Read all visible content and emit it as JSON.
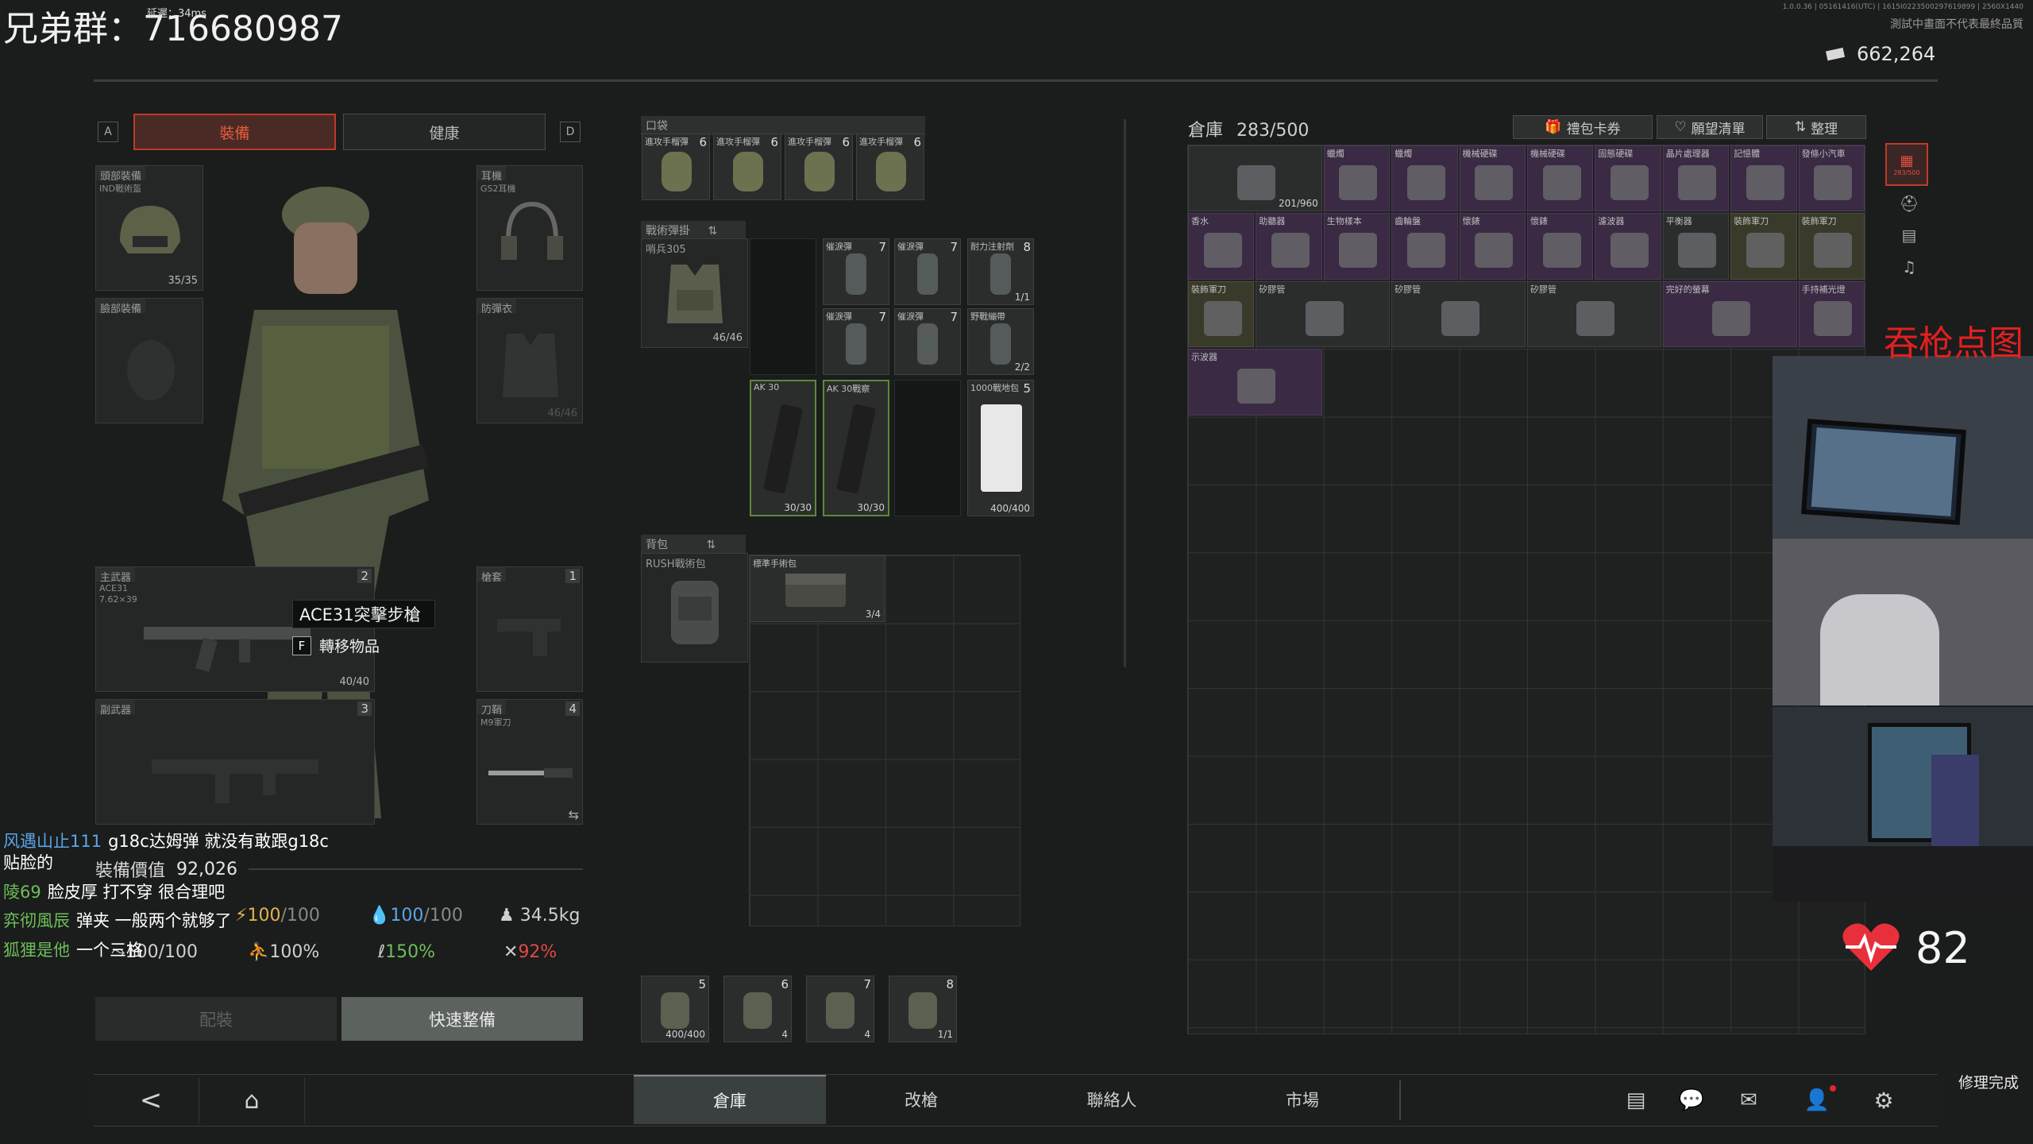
{
  "overlay": {
    "group_text": "兄弟群：716680987",
    "small_top": "毎出直戦地区",
    "delay_text": "延遲：34ms",
    "build_info": "1.0.0.36 | 05161416(UTC) | 1615I0223500297619899 | 2560X1440",
    "test_notice": "測試中畫面不代表最終品質"
  },
  "currency": {
    "amount": "662,264"
  },
  "loadout_tabs": {
    "left_key": "A",
    "equip": "裝備",
    "health": "健康",
    "right_key": "D"
  },
  "slots": {
    "head": {
      "label": "頭部裝備",
      "item": "IND戰術盔",
      "count": "35/35"
    },
    "earpiece": {
      "label": "耳機",
      "item": "GS2耳機"
    },
    "face": {
      "label": "臉部裝備"
    },
    "armor": {
      "label": "防彈衣",
      "count": "46/46"
    },
    "primary": {
      "label": "主武器",
      "item": "ACE31",
      "caliber": "7.62×39",
      "badge": "2",
      "count": "40/40"
    },
    "holster": {
      "label": "槍套",
      "badge": "1"
    },
    "secondary": {
      "label": "副武器",
      "badge": "3"
    },
    "knife": {
      "label": "刀鞘",
      "item": "M9軍刀",
      "badge": "4"
    }
  },
  "tooltip": {
    "title": "ACE31突擊步槍",
    "key": "F",
    "action": "轉移物品"
  },
  "stats": {
    "equip_value_label": "裝備價值",
    "equip_value": "92,026",
    "energy": "100",
    "energy_max": "/100",
    "water": "100",
    "water_max": "/100",
    "weight": "34.5kg",
    "stamina": "100/100",
    "speed": "100%",
    "stat3": "150%",
    "stat4": "92%"
  },
  "buttons": {
    "loadout": "配裝",
    "quick_equip": "快速整備",
    "repair_done": "修理完成"
  },
  "pockets": {
    "title": "口袋",
    "items": [
      {
        "label": "進攻手榴彈",
        "badge": "6"
      },
      {
        "label": "進攻手榴彈",
        "badge": "6"
      },
      {
        "label": "進攻手榴彈",
        "badge": "6"
      },
      {
        "label": "進攻手榴彈",
        "badge": "6"
      }
    ]
  },
  "rig": {
    "title": "戰術彈掛",
    "item": "哨兵305",
    "count": "46/46",
    "cells": [
      {
        "label": "催淚彈",
        "badge": "7"
      },
      {
        "label": "催淚彈",
        "badge": "7"
      },
      {
        "label": "耐力注射劑",
        "badge": "8",
        "count": "1/1"
      },
      {
        "label": "催淚彈",
        "badge": "7"
      },
      {
        "label": "催淚彈",
        "badge": "7"
      },
      {
        "label": "野戰繃帶",
        "count": "2/2"
      },
      {
        "label": "AK 30",
        "count": "30/30"
      },
      {
        "label": "AK 30戰察",
        "count": "30/30"
      },
      {
        "label": "1000戰地包",
        "badge": "5",
        "count": "400/400"
      }
    ]
  },
  "backpack": {
    "title": "背包",
    "item": "RUSH戰術包",
    "cells": [
      {
        "label": "標準手術包",
        "count": "3/4"
      }
    ]
  },
  "quickbar": [
    {
      "badge": "5",
      "count": "400/400"
    },
    {
      "badge": "6",
      "count": "4"
    },
    {
      "badge": "7",
      "count": "4"
    },
    {
      "badge": "8",
      "count": "1/1"
    }
  ],
  "stash": {
    "title": "倉庫",
    "capacity": "283/500",
    "gift_label": "禮包卡券",
    "wishlist_label": "願望清單",
    "sort_label": "整理",
    "side_badge": "283/500",
    "cells": [
      {
        "label": "",
        "count": "201/960"
      },
      {
        "label": "蠟燭"
      },
      {
        "label": "蠟燭"
      },
      {
        "label": "機械硬碟"
      },
      {
        "label": "機械硬碟"
      },
      {
        "label": "固態硬碟"
      },
      {
        "label": "晶片處理器"
      },
      {
        "label": "記憶體"
      },
      {
        "label": "發條小汽車"
      },
      {
        "label": "香水"
      },
      {
        "label": "助聽器"
      },
      {
        "label": "生物樣本"
      },
      {
        "label": "齒輪盤"
      },
      {
        "label": "懷錶"
      },
      {
        "label": "懷錶"
      },
      {
        "label": "濾波器"
      },
      {
        "label": "平衡器"
      },
      {
        "label": "裝飾軍刀"
      },
      {
        "label": "裝飾軍刀"
      },
      {
        "label": "裝飾軍刀"
      },
      {
        "label": "矽膠管"
      },
      {
        "label": "矽膠管"
      },
      {
        "label": "矽膠管"
      },
      {
        "label": "完好的螢幕"
      },
      {
        "label": "手持補光燈"
      },
      {
        "label": "示波器"
      }
    ]
  },
  "chat": [
    {
      "name": "风遇山止111",
      "text": "g18c达姆弹 就没有敢跟g18c"
    },
    {
      "name": "",
      "text": "贴脸的"
    },
    {
      "name": "陵69",
      "text": "脸皮厚 打不穿 很合理吧"
    },
    {
      "name": "弈彻風辰",
      "text": "弹夹 一般两个就够了"
    },
    {
      "name": "狐狸是他",
      "text": "一个三格"
    }
  ],
  "overlay_red": "吞枪点图",
  "heart_rate": "82",
  "bottom_nav": {
    "stash": "倉庫",
    "modify": "改槍",
    "contacts": "聯絡人",
    "market": "市場"
  },
  "colors": {
    "accent_red": "#c0392b",
    "gold": "#e0b44a",
    "blue": "#5aa6e8",
    "green": "#6dbf5a",
    "red_stat": "#e04848"
  }
}
